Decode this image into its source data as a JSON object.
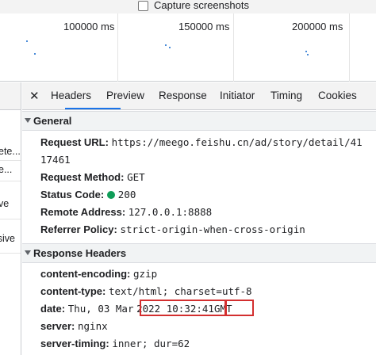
{
  "capture": {
    "label": "Capture screenshots"
  },
  "timeline": {
    "labels": [
      "100000 ms",
      "150000 ms",
      "200000 ms"
    ]
  },
  "left_list": {
    "items": [
      "ete...",
      "e...",
      "ve",
      "isive"
    ]
  },
  "tabs": {
    "items": [
      "Headers",
      "Preview",
      "Response",
      "Initiator",
      "Timing",
      "Cookies"
    ],
    "active": "Headers"
  },
  "general": {
    "title": "General",
    "request_url_key": "Request URL:",
    "request_url_val_1": "https://meego.feishu.cn/ad/story/detail/41",
    "request_url_val_2": "17461",
    "method_key": "Request Method:",
    "method_val": "GET",
    "status_key": "Status Code:",
    "status_val": "200",
    "remote_key": "Remote Address:",
    "remote_val": "127.0.0.1:8888",
    "referrer_key": "Referrer Policy:",
    "referrer_val": "strict-origin-when-cross-origin"
  },
  "response_headers": {
    "title": "Response Headers",
    "encoding_key": "content-encoding:",
    "encoding_val": "gzip",
    "type_key": "content-type:",
    "type_val": "text/html; charset=utf-8",
    "date_key": "date:",
    "date_prefix": "Thu, 03 Mar",
    "date_time": "2022 10:32:41",
    "date_tz": "GMT",
    "server_key": "server:",
    "server_val": "nginx",
    "timing_key": "server-timing:",
    "timing_val": "inner; dur=62"
  },
  "colors": {
    "accent": "#1a73e8",
    "status_ok": "#0f9d58",
    "highlight": "#d32f2f"
  }
}
